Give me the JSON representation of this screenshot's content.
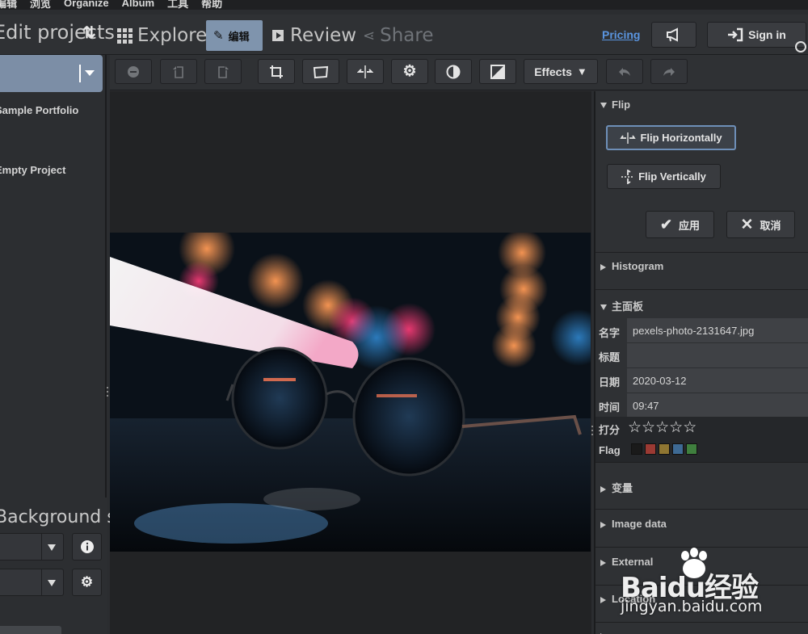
{
  "menu": [
    "编辑",
    "浏览",
    "Organize",
    "Album",
    "工具",
    "帮助"
  ],
  "header": {
    "projects_title": "Edit projects",
    "nav": {
      "explore": "Explore",
      "edit": "编辑",
      "review": "Review",
      "share": "Share"
    },
    "pricing": "Pricing",
    "signin": "Sign in"
  },
  "sidebar": {
    "projects": [
      "Sample Portfolio",
      "Empty Project"
    ],
    "style_title": "Background style"
  },
  "toolbar": {
    "effects_label": "Effects"
  },
  "panel": {
    "flip": {
      "title": "Flip",
      "horizontal": "Flip Horizontally",
      "vertical": "Flip Vertically",
      "apply": "应用",
      "cancel": "取消"
    },
    "histogram": "Histogram",
    "main_title": "主面板",
    "fields": {
      "name_label": "名字",
      "name_value": "pexels-photo-2131647.jpg",
      "title_label": "标题",
      "title_value": "",
      "date_label": "日期",
      "date_value": "2020-03-12",
      "time_label": "时间",
      "time_value": "09:47",
      "rating_label": "打分",
      "rating": 0,
      "rating_max": 5,
      "flag_label": "Flag"
    },
    "flag_colors": [
      "#1a1a1a",
      "#9b3a33",
      "#8f7632",
      "#3e6a94",
      "#3f7f3e"
    ],
    "sections": [
      "变量",
      "Image data",
      "External",
      "Location"
    ]
  },
  "watermark": {
    "logo": "Baidu经验",
    "url": "jingyan.baidu.com"
  },
  "accent_color": "#7f94ad"
}
